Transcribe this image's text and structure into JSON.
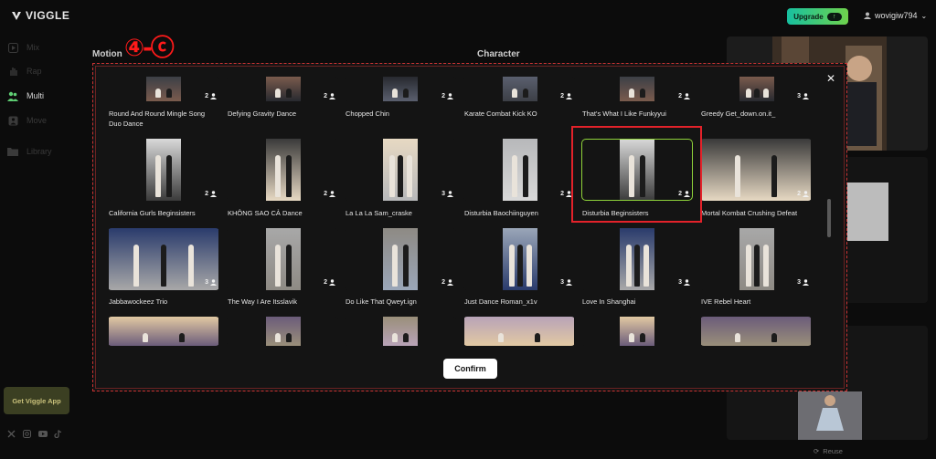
{
  "app": {
    "logo": "VIGGLE",
    "upgrade_label": "Upgrade",
    "username": "wovigiw794"
  },
  "sidebar": {
    "items": [
      {
        "label": "Mix",
        "icon": "play-square-icon"
      },
      {
        "label": "Rap",
        "icon": "hand-icon"
      },
      {
        "label": "Multi",
        "icon": "users-icon",
        "active": true
      },
      {
        "label": "Move",
        "icon": "person-box-icon"
      },
      {
        "label": "Library",
        "icon": "folder-icon"
      }
    ],
    "get_app": "Get Viggle App"
  },
  "sections": {
    "motion": "Motion",
    "character": "Character",
    "annotation": "④-ⓒ"
  },
  "modal": {
    "confirm": "Confirm",
    "rows": [
      [
        {
          "title": "Round And Round Mingle Song Duo Dance",
          "count": "2"
        },
        {
          "title": "Defying Gravity Dance",
          "count": "2"
        },
        {
          "title": "Chopped Chin",
          "count": "2"
        },
        {
          "title": "Karate Combat Kick KO",
          "count": "2"
        },
        {
          "title": "That's What I Like Funkyyui",
          "count": "2"
        },
        {
          "title": "Greedy Get_down.on.it_",
          "count": "3"
        }
      ],
      [
        {
          "title": "California Gurls Beginsisters",
          "count": "2"
        },
        {
          "title": "KHÔNG SAO CẢ Dance",
          "count": "2"
        },
        {
          "title": "La La La Sam_craske",
          "count": "3"
        },
        {
          "title": "Disturbia Baochiinguyen",
          "count": "2"
        },
        {
          "title": "Disturbia Beginsisters",
          "count": "2",
          "selected": true
        },
        {
          "title": "Mortal Kombat Crushing Defeat",
          "count": "2"
        }
      ],
      [
        {
          "title": "Jabbawockeez Trio",
          "count": "3"
        },
        {
          "title": "The Way I Are Itsslavik",
          "count": "2"
        },
        {
          "title": "Do Like That Qweyt.ign",
          "count": "2"
        },
        {
          "title": "Just Dance Roman_x1v",
          "count": "3"
        },
        {
          "title": "Love In Shanghai",
          "count": "3"
        },
        {
          "title": "IVE Rebel Heart",
          "count": "3"
        }
      ],
      [
        {
          "title": "",
          "count": ""
        },
        {
          "title": "",
          "count": ""
        },
        {
          "title": "",
          "count": ""
        },
        {
          "title": "",
          "count": ""
        },
        {
          "title": "",
          "count": ""
        },
        {
          "title": "",
          "count": ""
        }
      ]
    ]
  },
  "right_panel": {
    "reuse": "Reuse"
  },
  "colors": {
    "selected_border": "#8fd33a",
    "highlight_box": "#e3222a",
    "upgrade_gradient_start": "#17c0a0",
    "upgrade_gradient_end": "#6fd34c"
  }
}
